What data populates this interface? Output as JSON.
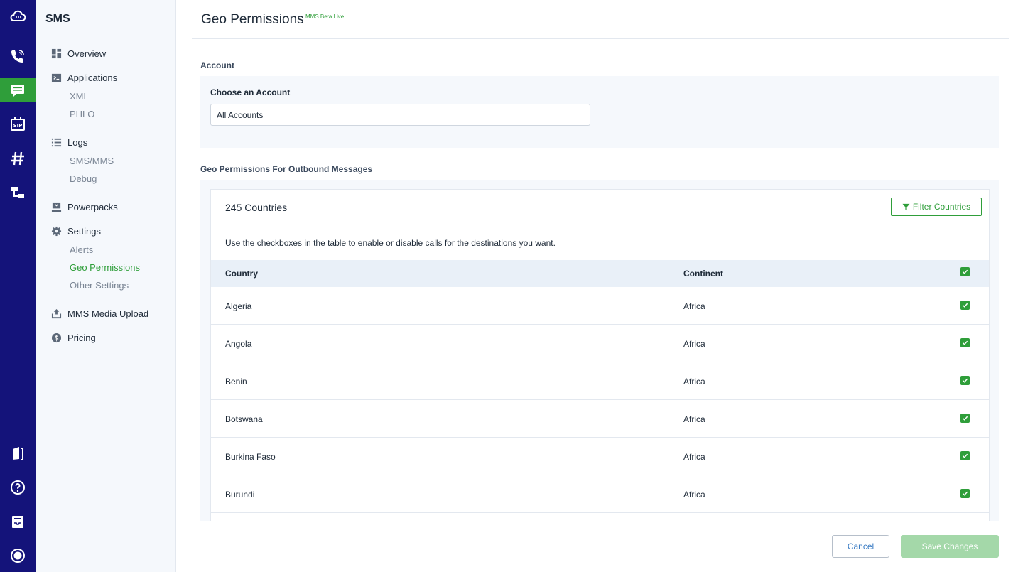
{
  "header": {
    "title": "Geo Permissions",
    "badge": "MMS Beta Live"
  },
  "rail": {
    "icons": [
      "cloud-icon",
      "voice-icon",
      "sms-icon",
      "sip-icon",
      "numbers-icon",
      "hierarchy-icon",
      "docs-icon",
      "help-icon",
      "inbox-icon",
      "profile-icon"
    ],
    "active": "sms-icon",
    "accent": "#2f9e3a",
    "background": "#14137a"
  },
  "sidebar": {
    "title": "SMS",
    "items": [
      {
        "label": "Overview",
        "icon": "dashboard-icon"
      },
      {
        "label": "Applications",
        "icon": "terminal-icon",
        "children": [
          "XML",
          "PHLO"
        ]
      },
      {
        "label": "Logs",
        "icon": "list-icon",
        "children": [
          "SMS/MMS",
          "Debug"
        ]
      },
      {
        "label": "Powerpacks",
        "icon": "powerpack-icon"
      },
      {
        "label": "Settings",
        "icon": "gear-icon",
        "children": [
          "Alerts",
          "Geo Permissions",
          "Other Settings"
        ],
        "active_child": "Geo Permissions"
      },
      {
        "label": "MMS Media Upload",
        "icon": "upload-icon"
      },
      {
        "label": "Pricing",
        "icon": "dollar-icon"
      }
    ]
  },
  "account": {
    "section_label": "Account",
    "choose_label": "Choose an Account",
    "selected": "All Accounts"
  },
  "geo": {
    "section_label": "Geo Permissions For Outbound Messages",
    "count_text": "245 Countries",
    "filter_label": "Filter Countries",
    "hint": "Use the checkboxes in the table to enable or disable calls for the destinations you want.",
    "columns": [
      "Country",
      "Continent"
    ],
    "header_checked": true,
    "rows": [
      {
        "country": "Algeria",
        "continent": "Africa",
        "checked": true
      },
      {
        "country": "Angola",
        "continent": "Africa",
        "checked": true
      },
      {
        "country": "Benin",
        "continent": "Africa",
        "checked": true
      },
      {
        "country": "Botswana",
        "continent": "Africa",
        "checked": true
      },
      {
        "country": "Burkina Faso",
        "continent": "Africa",
        "checked": true
      },
      {
        "country": "Burundi",
        "continent": "Africa",
        "checked": true
      }
    ]
  },
  "footer": {
    "cancel_label": "Cancel",
    "save_label": "Save Changes"
  }
}
